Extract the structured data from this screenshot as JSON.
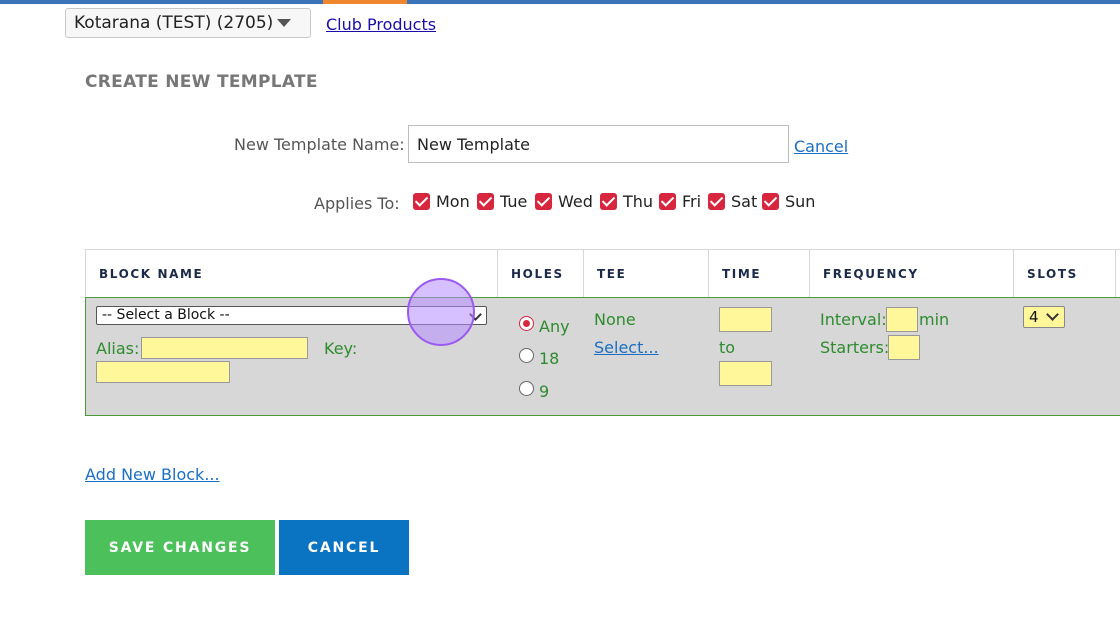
{
  "club_selector": {
    "value": "Kotarana (TEST) (2705)"
  },
  "club_products_link": "Club Products",
  "section_title": "CREATE NEW TEMPLATE",
  "template_name": {
    "label": "New Template Name:",
    "value": "New Template"
  },
  "cancel_link": "Cancel",
  "applies_to": {
    "label": "Applies To:",
    "days": [
      {
        "label": "Mon",
        "checked": true
      },
      {
        "label": "Tue",
        "checked": true
      },
      {
        "label": "Wed",
        "checked": true
      },
      {
        "label": "Thu",
        "checked": true
      },
      {
        "label": "Fri",
        "checked": true
      },
      {
        "label": "Sat",
        "checked": true
      },
      {
        "label": "Sun",
        "checked": true
      }
    ]
  },
  "table": {
    "headers": [
      "BLOCK NAME",
      "HOLES",
      "TEE",
      "TIME",
      "FREQUENCY",
      "SLOTS"
    ],
    "row": {
      "block_select": "-- Select a Block --",
      "alias_label": "Alias:",
      "key_label": "Key:",
      "holes_options": [
        {
          "label": "Any",
          "selected": true
        },
        {
          "label": "18",
          "selected": false
        },
        {
          "label": "9",
          "selected": false
        }
      ],
      "tee_value": "None",
      "tee_select_link": "Select...",
      "time_to_label": "to",
      "interval_label": "Interval:",
      "interval_unit": "min",
      "starters_label": "Starters:",
      "slots_value": "4"
    }
  },
  "add_block_link": "Add New Block...",
  "buttons": {
    "save": "SAVE CHANGES",
    "cancel": "CANCEL"
  },
  "colors": {
    "accent_green": "#4cc05a",
    "accent_blue": "#0b74c2",
    "checkbox_red": "#d7263d",
    "input_yellow": "#fff79a"
  }
}
